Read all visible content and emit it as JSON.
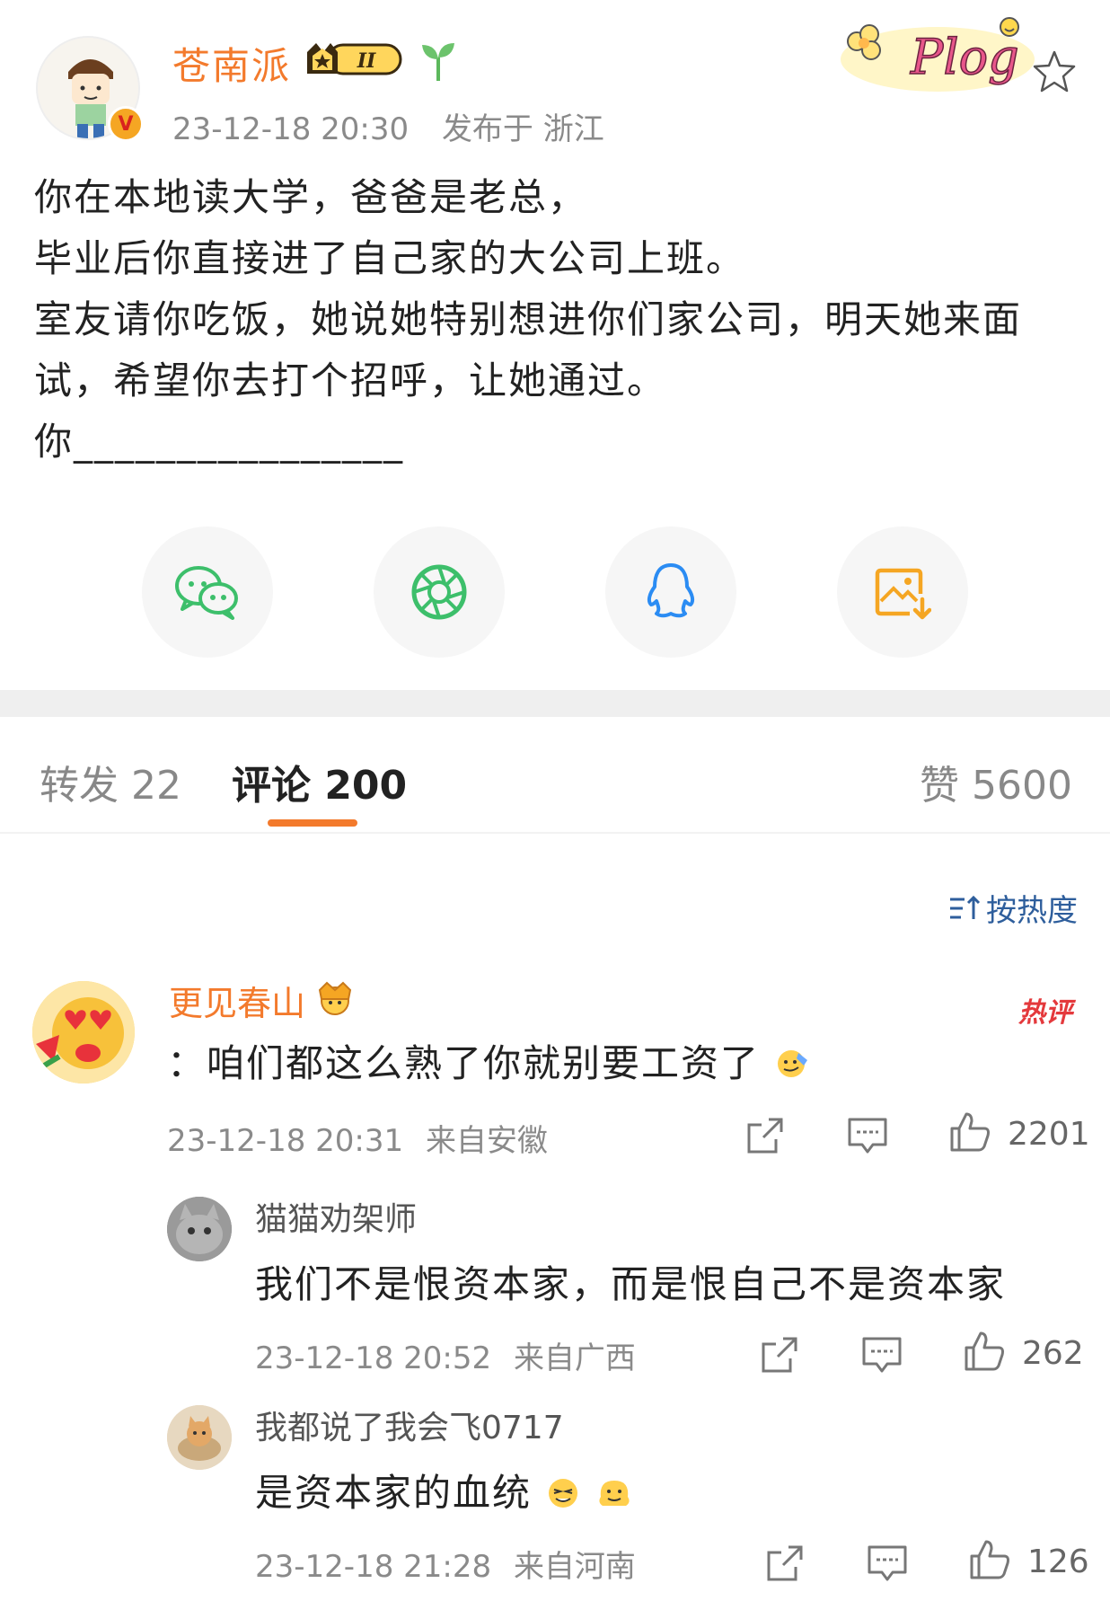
{
  "post": {
    "author": "苍南派",
    "level_badge": "II",
    "timestamp": "23-12-18 20:30",
    "location": "发布于 浙江",
    "sticker_text": "Plog",
    "body_lines": [
      "你在本地读大学，爸爸是老总，",
      "毕业后你直接进了自己家的大公司上班。",
      "室友请你吃饭，她说她特别想进你们家公司，明天她来面",
      "试，希望你去打个招呼，让她通过。",
      "你________________"
    ]
  },
  "share": [
    {
      "name": "wechat",
      "icon": "wechat-icon"
    },
    {
      "name": "moments",
      "icon": "moments-icon"
    },
    {
      "name": "qq",
      "icon": "qq-icon"
    },
    {
      "name": "save-image",
      "icon": "save-image-icon"
    }
  ],
  "tabs": {
    "repost": "转发 22",
    "comments": "评论 200",
    "likes": "赞 5600"
  },
  "sort_label": "按热度",
  "comments": [
    {
      "user": "更见春山",
      "text": "：咱们都这么熟了你就别要工资了",
      "time": "23-12-18 20:31",
      "from": "来自安徽",
      "likes": "2201",
      "hot": "热评"
    },
    {
      "user": "猫猫劝架师",
      "text": "我们不是恨资本家，而是恨自己不是资本家",
      "time": "23-12-18 20:52",
      "from": "来自广西",
      "likes": "262"
    },
    {
      "user": "我都说了我会飞0717",
      "text": "是资本家的血统",
      "time": "23-12-18 21:28",
      "from": "来自河南",
      "likes": "126"
    }
  ],
  "colors": {
    "accent": "#f37a2c",
    "link": "#2e5e9c",
    "muted": "#8a8a8a",
    "hot": "#e4393c"
  }
}
